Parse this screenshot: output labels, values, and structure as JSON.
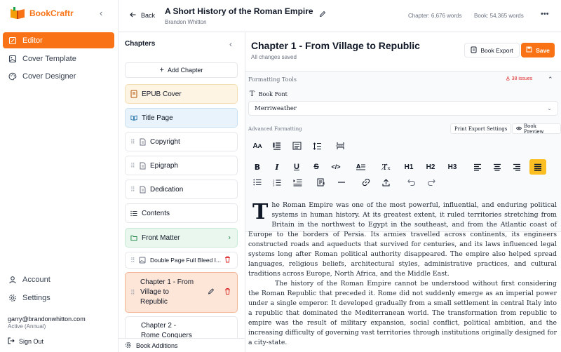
{
  "brand": {
    "name": "BookCraftr"
  },
  "nav": {
    "items": [
      {
        "label": "Editor",
        "icon": "edit-icon"
      },
      {
        "label": "Cover Template",
        "icon": "image-icon"
      },
      {
        "label": "Cover Designer",
        "icon": "palette-icon"
      }
    ],
    "bottom_items": [
      {
        "label": "Account",
        "icon": "user-icon"
      },
      {
        "label": "Settings",
        "icon": "gear-icon"
      }
    ],
    "user": {
      "email": "garry@brandonwhitton.com",
      "plan": "Active (Annual)"
    },
    "signout_label": "Sign Out",
    "accent_color": "#f97316"
  },
  "topbar": {
    "back_label": "Back",
    "book_title": "A Short History of the Roman Empire",
    "author": "Brandon Whitton",
    "chapter_words": "Chapter: 6,676 words",
    "book_words": "Book: 54,365 words"
  },
  "chapters": {
    "heading": "Chapters",
    "add_label": "Add Chapter",
    "items": [
      {
        "label": "EPUB Cover",
        "kind": "epub"
      },
      {
        "label": "Title Page",
        "kind": "title"
      },
      {
        "label": "Copyright",
        "kind": "page"
      },
      {
        "label": "Epigraph",
        "kind": "page"
      },
      {
        "label": "Dedication",
        "kind": "page"
      },
      {
        "label": "Contents",
        "kind": "list"
      },
      {
        "label": "Front Matter",
        "kind": "folder"
      },
      {
        "label": "Double Page Full Bleed I...",
        "kind": "image"
      },
      {
        "label": "Chapter 1 - From Village to Republic",
        "line1": "Chapter 1 - From",
        "line2": "Village to",
        "line3": "Republic",
        "kind": "active"
      },
      {
        "label": "Chapter 2 - Rome Conquers",
        "line1": "Chapter 2 -",
        "line2": "Rome Conquers",
        "kind": "chapter"
      }
    ],
    "book_additions_label": "Book Additions"
  },
  "editor": {
    "chapter_title": "Chapter 1 - From Village to Republic",
    "save_status": "All changes saved",
    "export_label": "Book Export",
    "save_label": "Save",
    "formatting": {
      "heading": "Formatting Tools",
      "issues": "38 issues",
      "book_font_label": "Book Font",
      "font_value": "Merriweather",
      "advanced_label": "Advanced Formatting",
      "print_export_label": "Print Export Settings",
      "preview_label": "Book Preview",
      "toolbar_row3": {
        "h1": "H1",
        "h2": "H2",
        "h3": "H3"
      }
    },
    "body": {
      "drop_cap": "T",
      "p1": "he Roman Empire was one of the most powerful, influential, and enduring political systems in human history. At its greatest extent, it ruled territories stretching from Britain in the northwest to Egypt in the southeast, and from the Atlantic coast of Europe to the borders of Persia. Its armies travelled across continents, its engineers constructed roads and aqueducts that survived for centuries, and its laws influenced legal systems long after Roman political authority disappeared. The empire also helped spread languages, religious beliefs, architectural styles, administrative practices, and cultural traditions across Europe, North Africa, and the Middle East.",
      "p2": "The history of the Roman Empire cannot be understood without first considering the Roman Republic that preceded it. Rome did not suddenly emerge as an imperial power under a single emperor. It developed gradually from a small settlement in central Italy into a republic that dominated the Mediterranean world. The transformation from republic to empire was the result of military expansion, social conflict, political ambition, and the increasing difficulty of governing vast territories through institutions originally designed for a city-state."
    }
  }
}
